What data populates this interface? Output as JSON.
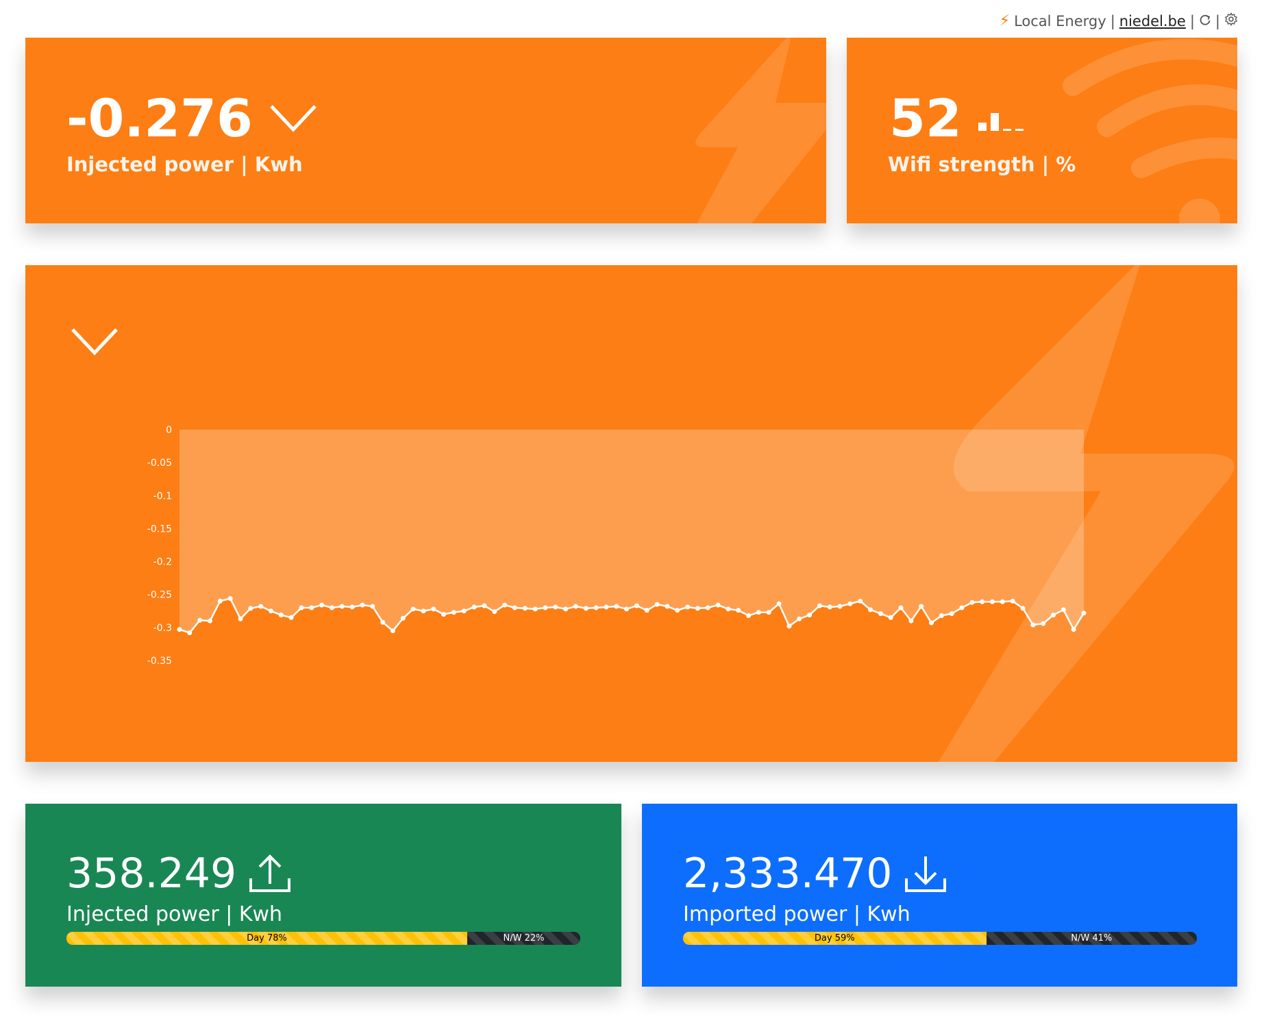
{
  "topbar": {
    "bolt_icon": "lightning-bolt-icon",
    "title": "Local Energy",
    "sep1": "|",
    "link": "niedel.be",
    "sep2": "|",
    "refresh_icon": "refresh-icon",
    "sep3": "|",
    "settings_icon": "gear-icon"
  },
  "injected_now": {
    "value": "-0.276",
    "label": "Injected power | Kwh",
    "trend_icon": "chevron-down-icon"
  },
  "wifi": {
    "value": "52",
    "label": "Wifi strength | %",
    "signal_icon": "signal-bars-icon",
    "signal_level": 2,
    "signal_max": 4
  },
  "chart_card": {
    "trend_icon": "chevron-down-icon"
  },
  "chart_data": {
    "type": "line",
    "title": "",
    "xlabel": "",
    "ylabel": "",
    "ylim": [
      -0.35,
      0
    ],
    "yticks": [
      "0",
      "-0.05",
      "-0.1",
      "-0.15",
      "-0.2",
      "-0.25",
      "-0.3",
      "-0.35"
    ],
    "series": [
      {
        "values": [
          -0.303,
          -0.308,
          -0.289,
          -0.29,
          -0.26,
          -0.256,
          -0.287,
          -0.271,
          -0.268,
          -0.275,
          -0.281,
          -0.285,
          -0.27,
          -0.27,
          -0.266,
          -0.27,
          -0.268,
          -0.269,
          -0.266,
          -0.268,
          -0.292,
          -0.305,
          -0.286,
          -0.272,
          -0.275,
          -0.272,
          -0.28,
          -0.277,
          -0.275,
          -0.269,
          -0.267,
          -0.276,
          -0.266,
          -0.27,
          -0.271,
          -0.272,
          -0.27,
          -0.269,
          -0.272,
          -0.268,
          -0.271,
          -0.27,
          -0.269,
          -0.268,
          -0.272,
          -0.267,
          -0.274,
          -0.265,
          -0.268,
          -0.274,
          -0.269,
          -0.271,
          -0.27,
          -0.266,
          -0.272,
          -0.274,
          -0.282,
          -0.277,
          -0.277,
          -0.264,
          -0.298,
          -0.287,
          -0.281,
          -0.267,
          -0.269,
          -0.268,
          -0.264,
          -0.26,
          -0.273,
          -0.279,
          -0.285,
          -0.27,
          -0.29,
          -0.268,
          -0.293,
          -0.282,
          -0.279,
          -0.27,
          -0.262,
          -0.261,
          -0.261,
          -0.261,
          -0.26,
          -0.271,
          -0.296,
          -0.294,
          -0.281,
          -0.273,
          -0.303,
          -0.278
        ]
      }
    ],
    "area_fill": true
  },
  "injected_total": {
    "value": "358.249",
    "label": "Injected power | Kwh",
    "icon": "upload-icon",
    "bar": {
      "day_label": "Day 78%",
      "day_pct": 78,
      "nw_label": "N/W 22%",
      "nw_pct": 22
    }
  },
  "imported_total": {
    "value": "2,333.470",
    "label": "Imported power | Kwh",
    "icon": "download-icon",
    "bar": {
      "day_label": "Day 59%",
      "day_pct": 59,
      "nw_label": "N/W 41%",
      "nw_pct": 41
    }
  },
  "colors": {
    "orange": "#fd7e14",
    "green": "#198754",
    "blue": "#0d6efd",
    "day": "#ffc107",
    "night": "#212529"
  }
}
